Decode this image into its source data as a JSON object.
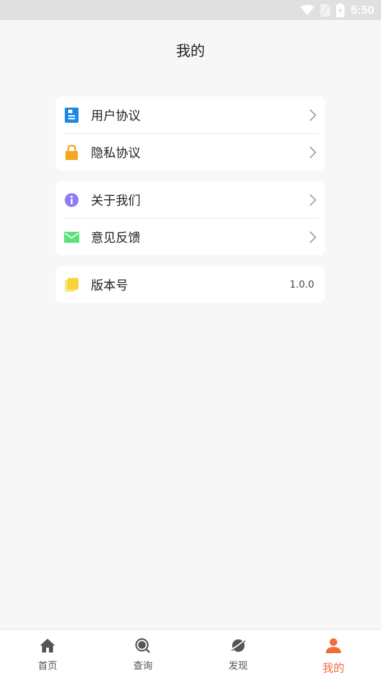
{
  "status_bar": {
    "time": "5:50"
  },
  "header": {
    "title": "我的"
  },
  "group1": {
    "items": [
      {
        "label": "用户协议",
        "icon": "document-icon",
        "color": "#1e88e5"
      },
      {
        "label": "隐私协议",
        "icon": "lock-icon",
        "color": "#f5a623"
      }
    ]
  },
  "group2": {
    "items": [
      {
        "label": "关于我们",
        "icon": "info-icon",
        "color": "#8f7cf0"
      },
      {
        "label": "意见反馈",
        "icon": "mail-icon",
        "color": "#5ee07a"
      }
    ]
  },
  "group3": {
    "items": [
      {
        "label": "版本号",
        "icon": "version-icon",
        "color": "#f8d33a",
        "value": "1.0.0"
      }
    ]
  },
  "tabbar": {
    "tabs": [
      {
        "label": "首页",
        "icon": "home-icon"
      },
      {
        "label": "查询",
        "icon": "search-icon"
      },
      {
        "label": "发现",
        "icon": "discover-icon"
      },
      {
        "label": "我的",
        "icon": "user-icon",
        "active": true
      }
    ],
    "active_color": "#f36a3d",
    "inactive_color": "#555555"
  }
}
